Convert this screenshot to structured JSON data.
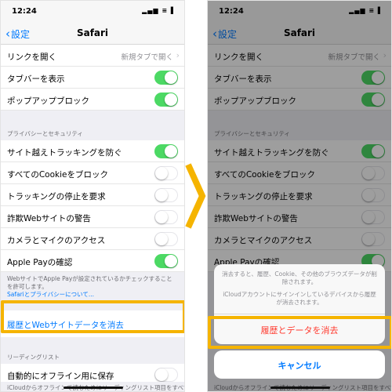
{
  "status": {
    "time": "12:24",
    "arrow_glyph": "➚",
    "icons": "▂▄▆ ≡ ▌"
  },
  "nav": {
    "back_label": "設定",
    "title": "Safari"
  },
  "rows_top": [
    {
      "label": "リンクを開く",
      "value": "新規タブで開く"
    },
    {
      "label": "タブバーを表示",
      "switch": "on"
    },
    {
      "label": "ポップアップブロック",
      "switch": "on"
    }
  ],
  "privacy_header": "プライバシーとセキュリティ",
  "privacy_rows": [
    {
      "label": "サイト越えトラッキングを防ぐ",
      "switch": "on"
    },
    {
      "label": "すべてのCookieをブロック",
      "switch": "off"
    },
    {
      "label": "トラッキングの停止を要求",
      "switch": "off"
    },
    {
      "label": "詐欺Webサイトの警告",
      "switch": "off"
    },
    {
      "label": "カメラとマイクのアクセス",
      "switch": "off"
    },
    {
      "label": "Apple Payの確認",
      "switch": "on"
    }
  ],
  "privacy_footer": {
    "text": "WebサイトでApple Payが設定されているかチェックすることを許可します。",
    "link": "Safariとプライバシーについて..."
  },
  "clear_history_label": "履歴とWebサイトデータを消去",
  "reading_list_header": "リーディングリスト",
  "offline_row": {
    "label": "自動的にオフライン用に保存",
    "switch": "off"
  },
  "bottom_text": "iCloudからオフラインで読むためにリーディングリスト項目をすべて",
  "sheet": {
    "message1": "消去すると、履歴、Cookie、その他のブラウズデータが削除されます。",
    "message2": "iCloudアカウントにサインインしているデバイスから履歴が消去されます。",
    "destructive_label": "履歴とデータを消去",
    "cancel_label": "キャンセル"
  },
  "colors": {
    "accent": "#007aff",
    "switch_on": "#4cd964",
    "highlight": "#f5b400",
    "destructive": "#ff3b30"
  }
}
